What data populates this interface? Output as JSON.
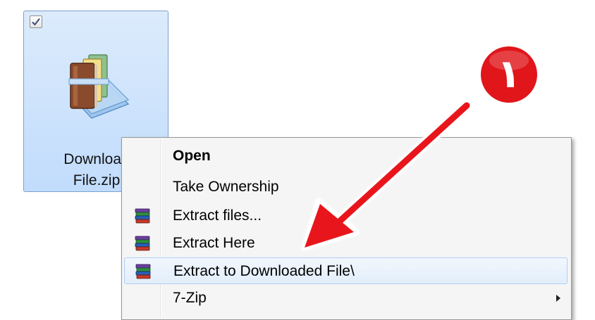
{
  "file": {
    "name_line1": "Download",
    "name_line2": "File.zip",
    "icon": "winrar-archive-icon",
    "selected": true,
    "checkbox_checked": true
  },
  "context_menu": {
    "items": [
      {
        "label": "Open",
        "bold": true,
        "icon": ""
      },
      {
        "label": "Take Ownership",
        "bold": false,
        "icon": ""
      },
      {
        "label": "Extract files...",
        "bold": false,
        "icon": "winrar-books-icon"
      },
      {
        "label": "Extract Here",
        "bold": false,
        "icon": "winrar-books-icon"
      },
      {
        "label": "Extract to Downloaded File\\",
        "bold": false,
        "icon": "winrar-books-icon",
        "highlighted": true
      },
      {
        "label": "7-Zip",
        "bold": false,
        "icon": "",
        "submenu": true
      }
    ]
  },
  "annotation": {
    "step_number": "١",
    "badge_color": "#e0161b",
    "arrow_color": "#e8141c"
  }
}
